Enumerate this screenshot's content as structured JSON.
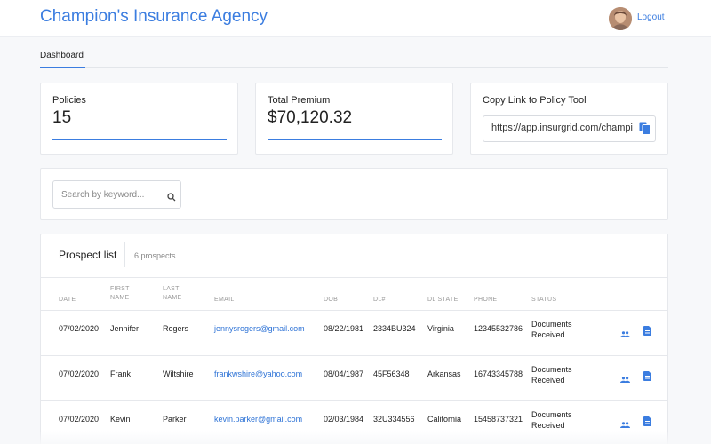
{
  "header": {
    "brand": "Champion's Insurance Agency",
    "logout_label": "Logout"
  },
  "tabs": [
    {
      "label": "Dashboard",
      "active": true
    }
  ],
  "stats": {
    "policies": {
      "label": "Policies",
      "value": "15"
    },
    "total_premium": {
      "label": "Total Premium",
      "value": "$70,120.32"
    },
    "policy_link": {
      "label": "Copy Link to Policy Tool",
      "value": "https://app.insurgrid.com/champi"
    }
  },
  "search": {
    "placeholder": "Search by keyword...",
    "value": ""
  },
  "prospects": {
    "title": "Prospect list",
    "count": "6 prospects",
    "columns": [
      {
        "key": "date",
        "lines": [
          "DATE"
        ]
      },
      {
        "key": "first",
        "lines": [
          "FIRST",
          "NAME"
        ]
      },
      {
        "key": "last",
        "lines": [
          "LAST",
          "NAME"
        ]
      },
      {
        "key": "email",
        "lines": [
          "EMAIL"
        ]
      },
      {
        "key": "dob",
        "lines": [
          "DOB"
        ]
      },
      {
        "key": "dl",
        "lines": [
          "DL#"
        ]
      },
      {
        "key": "dlstate",
        "lines": [
          "DL STATE"
        ]
      },
      {
        "key": "phone",
        "lines": [
          "PHONE"
        ]
      },
      {
        "key": "status",
        "lines": [
          "STATUS"
        ]
      }
    ],
    "rows": [
      {
        "date": "07/02/2020",
        "first": "Jennifer",
        "last": "Rogers",
        "email": "jennysrogers@gmail.com",
        "dob": "08/22/1981",
        "dl": "2334BU324",
        "dlstate": "Virginia",
        "phone": "12345532786",
        "status": [
          "Documents",
          "Received"
        ]
      },
      {
        "date": "07/02/2020",
        "first": "Frank",
        "last": "Wiltshire",
        "email": "frankwshire@yahoo.com",
        "dob": "08/04/1987",
        "dl": "45F56348",
        "dlstate": "Arkansas",
        "phone": "16743345788",
        "status": [
          "Documents",
          "Received"
        ]
      },
      {
        "date": "07/02/2020",
        "first": "Kevin",
        "last": "Parker",
        "email": "kevin.parker@gmail.com",
        "dob": "02/03/1984",
        "dl": "32U334556",
        "dlstate": "California",
        "phone": "15458737321",
        "status": [
          "Documents",
          "Received"
        ]
      }
    ]
  },
  "icons": {
    "copy": "copy-icon",
    "search": "search-icon",
    "people": "people-icon",
    "document": "document-icon"
  },
  "colors": {
    "accent": "#3b7de0",
    "link": "#2e73d6"
  }
}
